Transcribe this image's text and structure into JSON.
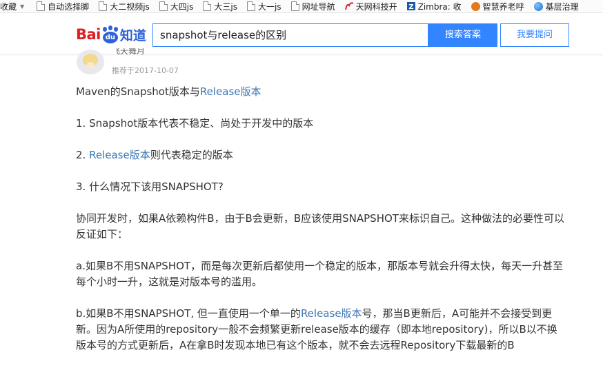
{
  "bookmarks": {
    "favorites_label": "收藏",
    "items": [
      {
        "label": "自动选择脚",
        "icon": "page-icon"
      },
      {
        "label": "大二视频js",
        "icon": "page-icon"
      },
      {
        "label": "大四js",
        "icon": "page-icon"
      },
      {
        "label": "大三js",
        "icon": "page-icon"
      },
      {
        "label": "大一js",
        "icon": "page-icon"
      },
      {
        "label": "网址导航",
        "icon": "page-icon"
      },
      {
        "label": "天网科技开",
        "icon": "tianwang-logo-icon"
      },
      {
        "label": "Zimbra: 收",
        "icon": "zimbra-logo-icon"
      },
      {
        "label": "智慧养老呼",
        "icon": "smart-elder-logo-icon"
      },
      {
        "label": "基层治理",
        "icon": "globe-icon"
      }
    ]
  },
  "header": {
    "logo_bai": "Bai",
    "logo_du": "du",
    "logo_zhidao": "知道",
    "search_value": "snapshot与release的区别",
    "search_button": "搜索答案",
    "ask_button": "我要提问"
  },
  "author": {
    "name": "飞天舞月",
    "date": "推荐于2017-10-07"
  },
  "article": {
    "p1_a": "Maven的Snapshot版本与",
    "p1_link": "Release版本",
    "p2": "1. Snapshot版本代表不稳定、尚处于开发中的版本",
    "p3_a": "2. ",
    "p3_link": "Release版本",
    "p3_b": "则代表稳定的版本",
    "p4": "3. 什么情况下该用SNAPSHOT?",
    "p5": "协同开发时，如果A依赖构件B，由于B会更新，B应该使用SNAPSHOT来标识自己。这种做法的必要性可以反证如下：",
    "p6": "a.如果B不用SNAPSHOT，而是每次更新后都使用一个稳定的版本，那版本号就会升得太快，每天一升甚至每个小时一升，这就是对版本号的滥用。",
    "p7_a": "b.如果B不用SNAPSHOT, 但一直使用一个单一的",
    "p7_link": "Release版本",
    "p7_b": "号，那当B更新后，A可能并不会接受到更新。因为A所使用的repository一般不会频繁更新release版本的缓存（即本地repository)，所以B以不换版本号的方式更新后，A在拿B时发现本地已有这个版本，就不会去远程Repository下载最新的B"
  },
  "colors": {
    "accent": "#3385ff",
    "link": "#3c75b5",
    "brand_red": "#de1d20",
    "brand_blue": "#2d62d8"
  }
}
